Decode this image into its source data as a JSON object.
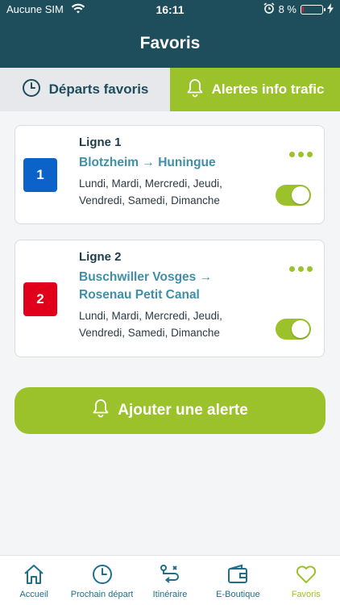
{
  "status": {
    "carrier": "Aucune SIM",
    "time": "16:11",
    "battery": "8 %",
    "battery_level": 0.08
  },
  "header": {
    "title": "Favoris"
  },
  "tabs": [
    {
      "label": "Départs favoris",
      "icon": "clock-icon",
      "active": false
    },
    {
      "label": "Alertes info trafic",
      "icon": "bell-icon",
      "active": true
    }
  ],
  "alerts": [
    {
      "line": "Ligne 1",
      "badge": "1",
      "badge_color": "#0b63c9",
      "from": "Blotzheim",
      "to": "Huningue",
      "days": [
        "Lundi, Mardi, Mercredi, Jeudi,",
        "Vendredi, Samedi, Dimanche"
      ],
      "enabled": true
    },
    {
      "line": "Ligne 2",
      "badge": "2",
      "badge_color": "#e0001b",
      "from": "Buschwiller Vosges",
      "to": "Rosenau Petit Canal",
      "days": [
        "Lundi, Mardi, Mercredi, Jeudi,",
        "Vendredi, Samedi, Dimanche"
      ],
      "enabled": true
    }
  ],
  "add_button": {
    "label": "Ajouter une alerte"
  },
  "tabbar": [
    {
      "label": "Accueil",
      "icon": "home-icon"
    },
    {
      "label": "Prochain départ",
      "icon": "clock-icon"
    },
    {
      "label": "Itinéraire",
      "icon": "route-icon"
    },
    {
      "label": "E-Boutique",
      "icon": "wallet-icon"
    },
    {
      "label": "Favoris",
      "icon": "heart-icon",
      "active": true
    }
  ],
  "colors": {
    "primary": "#1e4d5c",
    "accent": "#9cc22b",
    "link": "#3f8fa8"
  }
}
